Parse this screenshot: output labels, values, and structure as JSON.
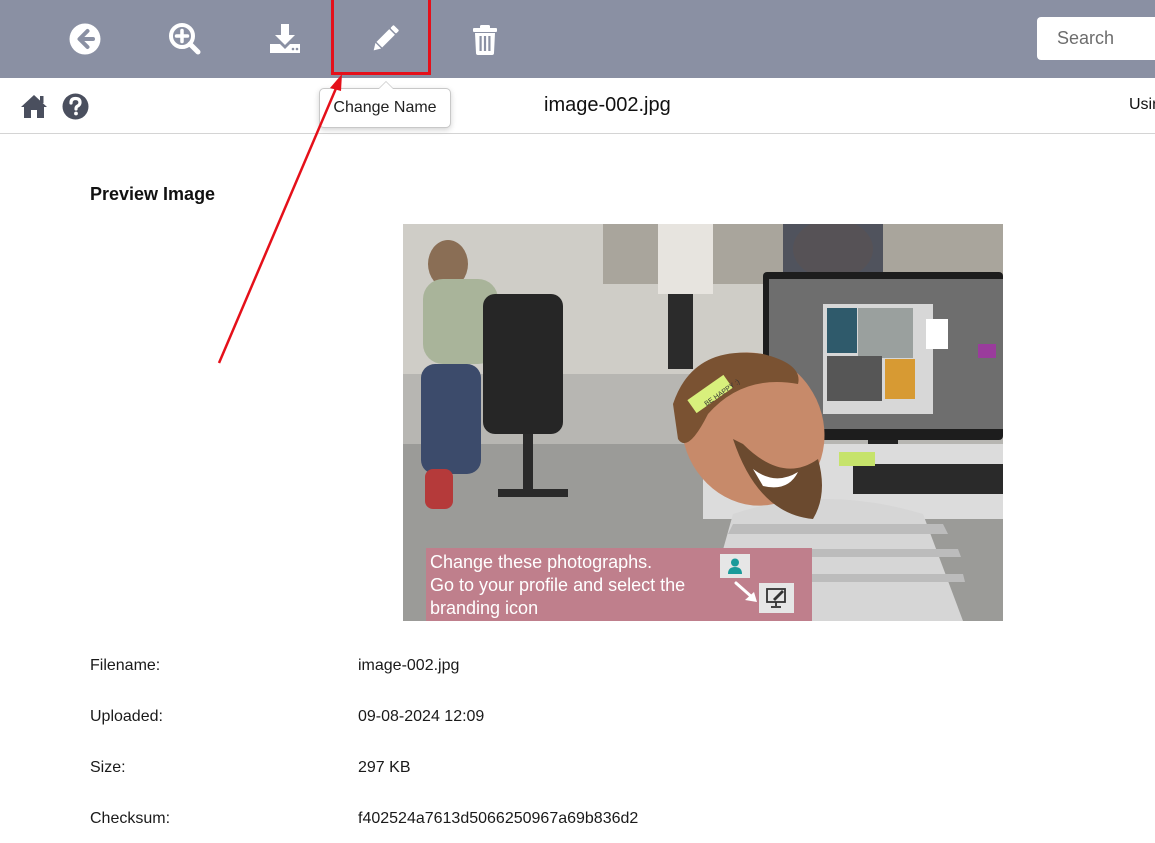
{
  "toolbar": {
    "buttons": [
      {
        "name": "back",
        "icon": "arrow-left-circle-icon"
      },
      {
        "name": "zoom",
        "icon": "zoom-in-icon"
      },
      {
        "name": "download",
        "icon": "download-icon"
      },
      {
        "name": "change-name",
        "icon": "pencil-icon",
        "tooltip": "Change Name"
      },
      {
        "name": "delete",
        "icon": "trash-icon"
      }
    ],
    "search": {
      "placeholder": "Search"
    },
    "background_color": "#8a90a3"
  },
  "subbar": {
    "title": "image-002.jpg",
    "user_text": "Usir",
    "icons": [
      "home-icon",
      "help-circle-icon"
    ]
  },
  "tooltip": {
    "label": "Change Name"
  },
  "annotation": {
    "highlight_color": "#e5101a"
  },
  "main": {
    "section_title": "Preview Image",
    "preview": {
      "banner_lines": [
        "Change these photographs.",
        "Go to your profile and select the",
        "branding icon"
      ],
      "banner_color": "#bf7f8c",
      "sticky_note_text": "BE HAPPY :)"
    },
    "details": [
      {
        "label": "Filename:",
        "value": "image-002.jpg"
      },
      {
        "label": "Uploaded:",
        "value": "09-08-2024 12:09"
      },
      {
        "label": "Size:",
        "value": "297 KB"
      },
      {
        "label": "Checksum:",
        "value": "f402524a7613d5066250967a69b836d2"
      }
    ]
  }
}
